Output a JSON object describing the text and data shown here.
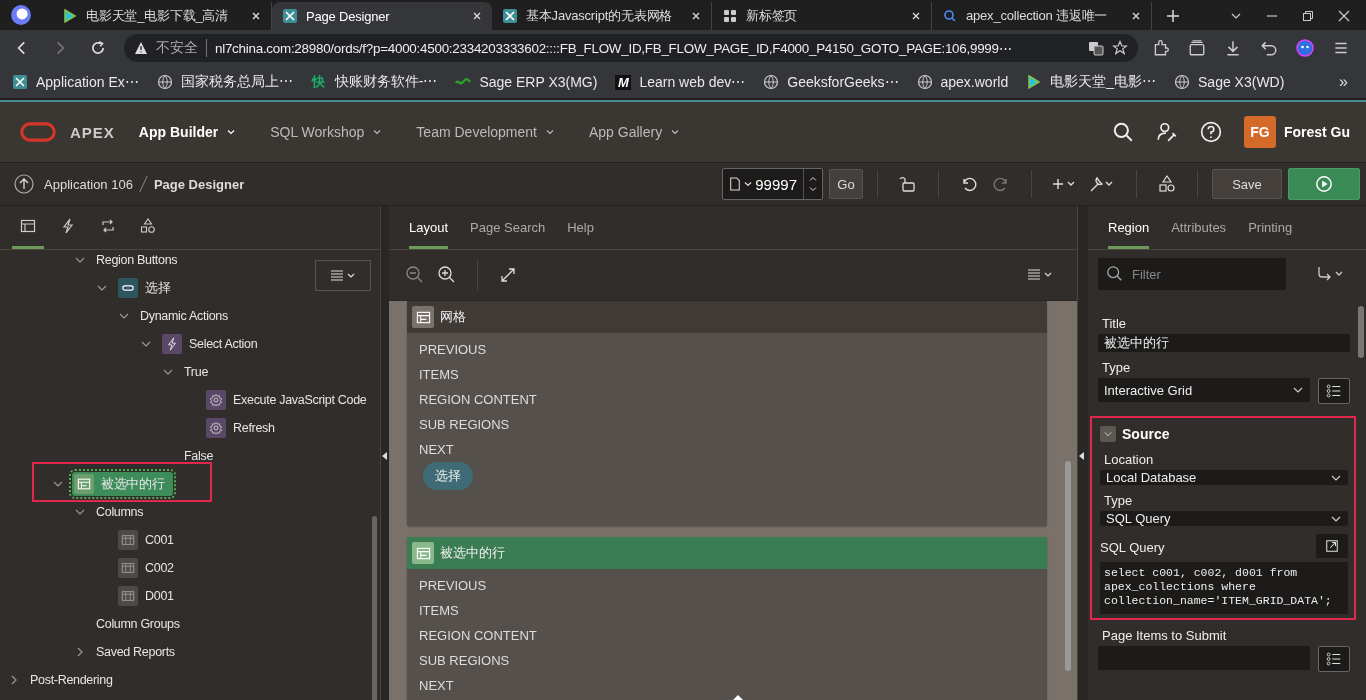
{
  "browser": {
    "tabs": [
      {
        "title": "电影天堂_电影下载_高清",
        "selected": false,
        "kind": "film"
      },
      {
        "title": "Page Designer",
        "selected": true,
        "kind": "apex"
      },
      {
        "title": "基本Javascript的无表网格",
        "selected": false,
        "kind": "apex"
      },
      {
        "title": "新标签页",
        "selected": false,
        "kind": "grid"
      },
      {
        "title": "apex_collection 违返唯一",
        "selected": false,
        "kind": "search"
      }
    ],
    "address": {
      "security": "不安全",
      "url": "nl7china.com:28980/ords/f?p=4000:4500:2334203333602::::FB_FLOW_ID,FB_FLOW_PAGE_ID,F4000_P4150_GOTO_PAGE:106,9999⋯"
    },
    "bookmarks": [
      {
        "label": "Application Ex⋯",
        "kind": "apex"
      },
      {
        "label": "国家税务总局上⋯",
        "kind": "globe"
      },
      {
        "label": "快账财务软件-⋯",
        "kind": "letter",
        "mark": "快"
      },
      {
        "label": "Sage ERP X3(MG)",
        "kind": "sage"
      },
      {
        "label": "Learn web dev⋯",
        "kind": "letter",
        "mark": "M"
      },
      {
        "label": "GeeksforGeeks⋯",
        "kind": "globe"
      },
      {
        "label": "apex.world",
        "kind": "globe"
      },
      {
        "label": "电影天堂_电影⋯",
        "kind": "film"
      },
      {
        "label": "Sage X3(WD)",
        "kind": "globe"
      }
    ],
    "more": "»"
  },
  "header": {
    "product": "APEX",
    "nav": [
      {
        "label": "App Builder",
        "selected": true
      },
      {
        "label": "SQL Workshop",
        "selected": false
      },
      {
        "label": "Team Development",
        "selected": false
      },
      {
        "label": "App Gallery",
        "selected": false
      }
    ],
    "user": {
      "initials": "FG",
      "name": "Forest Gu"
    }
  },
  "toolbar": {
    "parent": "Application 106",
    "current": "Page Designer",
    "page_number": "99997",
    "go": "Go",
    "save": "Save"
  },
  "left_panel": {
    "tabs": [
      {
        "kind": "rendering",
        "selected": true
      },
      {
        "kind": "dynamic",
        "selected": false
      },
      {
        "kind": "processing",
        "selected": false
      },
      {
        "kind": "shared",
        "selected": false
      }
    ],
    "tree": [
      {
        "children": [
          {
            "children": [
              {
                "children": [
                  {
                    "label": "Region Buttons",
                    "expanded": true,
                    "selected": false,
                    "children": [
                      {
                        "label": "选择",
                        "kind": "button",
                        "expanded": true,
                        "selected": false,
                        "children": [
                          {
                            "label": "Dynamic Actions",
                            "expanded": true,
                            "selected": false,
                            "children": [
                              {
                                "label": "Select Action",
                                "kind": "event",
                                "expanded": true,
                                "selected": false,
                                "children": [
                                  {
                                    "label": "True",
                                    "expanded": true,
                                    "selected": false,
                                    "children": [
                                      {
                                        "label": "Execute JavaScript Code",
                                        "kind": "action",
                                        "selected": false
                                      },
                                      {
                                        "label": "Refresh",
                                        "kind": "action",
                                        "selected": false
                                      }
                                    ]
                                  },
                                  {
                                    "label": "False",
                                    "selected": false
                                  }
                                ]
                              }
                            ]
                          }
                        ]
                      }
                    ]
                  }
                ]
              },
              {
                "label": "被选中的行",
                "kind": "region",
                "expanded": true,
                "selected": true,
                "highlighted": true,
                "children": [
                  {
                    "label": "Columns",
                    "expanded": true,
                    "selected": false,
                    "children": [
                      {
                        "label": "C001",
                        "kind": "column",
                        "selected": false
                      },
                      {
                        "label": "C002",
                        "kind": "column",
                        "selected": false
                      },
                      {
                        "label": "D001",
                        "kind": "column",
                        "selected": false
                      }
                    ]
                  },
                  {
                    "label": "Column Groups",
                    "selected": false
                  },
                  {
                    "label": "Saved Reports",
                    "expanded": false,
                    "selected": false
                  }
                ]
              }
            ]
          }
        ]
      },
      {
        "label": "Post-Rendering",
        "expanded": false,
        "selected": false
      }
    ]
  },
  "center": {
    "tabs": [
      {
        "label": "Layout",
        "selected": true
      },
      {
        "label": "Page Search",
        "selected": false
      },
      {
        "label": "Help",
        "selected": false
      }
    ],
    "regions": [
      {
        "title": "网格",
        "selected": false,
        "positions": [
          "PREVIOUS",
          "ITEMS",
          "REGION CONTENT",
          "SUB REGIONS",
          "NEXT"
        ],
        "buttons": [
          "选择"
        ]
      },
      {
        "title": "被选中的行",
        "selected": true,
        "positions": [
          "PREVIOUS",
          "ITEMS",
          "REGION CONTENT",
          "SUB REGIONS",
          "NEXT"
        ]
      }
    ]
  },
  "properties": {
    "tabs": [
      {
        "label": "Region",
        "selected": true
      },
      {
        "label": "Attributes",
        "selected": false
      },
      {
        "label": "Printing",
        "selected": false
      }
    ],
    "filter": {
      "placeholder": "Filter"
    },
    "title": {
      "label": "Title",
      "value": "被选中的行"
    },
    "type": {
      "label": "Type",
      "value": "Interactive Grid"
    },
    "source": {
      "heading": "Source",
      "expanded": true,
      "highlighted": true,
      "location": {
        "label": "Location",
        "value": "Local Database"
      },
      "type": {
        "label": "Type",
        "value": "SQL Query"
      },
      "sql": {
        "label": "SQL Query",
        "value": "select c001, c002, d001 from\napex_collections where\ncollection_name='ITEM_GRID_DATA';"
      }
    },
    "items_to_submit": {
      "label": "Page Items to Submit"
    }
  }
}
